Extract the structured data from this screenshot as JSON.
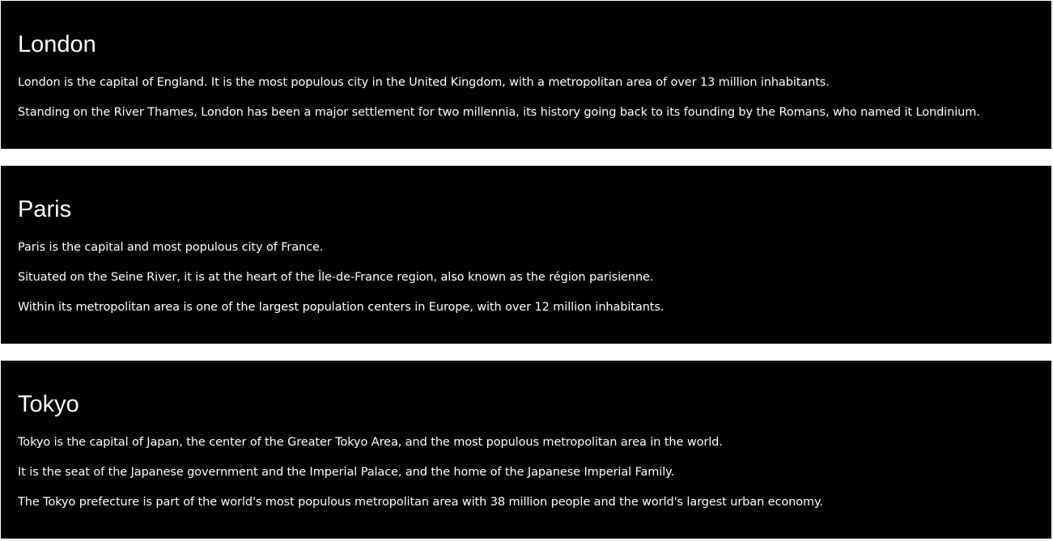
{
  "cities": [
    {
      "name": "London",
      "paragraphs": [
        "London is the capital of England. It is the most populous city in the United Kingdom, with a metropolitan area of over 13 million inhabitants.",
        "Standing on the River Thames, London has been a major settlement for two millennia, its history going back to its founding by the Romans, who named it Londinium."
      ]
    },
    {
      "name": "Paris",
      "paragraphs": [
        "Paris is the capital and most populous city of France.",
        "Situated on the Seine River, it is at the heart of the Île-de-France region, also known as the région parisienne.",
        "Within its metropolitan area is one of the largest population centers in Europe, with over 12 million inhabitants."
      ]
    },
    {
      "name": "Tokyo",
      "paragraphs": [
        "Tokyo is the capital of Japan, the center of the Greater Tokyo Area, and the most populous metropolitan area in the world.",
        "It is the seat of the Japanese government and the Imperial Palace, and the home of the Japanese Imperial Family.",
        "The Tokyo prefecture is part of the world's most populous metropolitan area with 38 million people and the world's largest urban economy."
      ]
    }
  ]
}
